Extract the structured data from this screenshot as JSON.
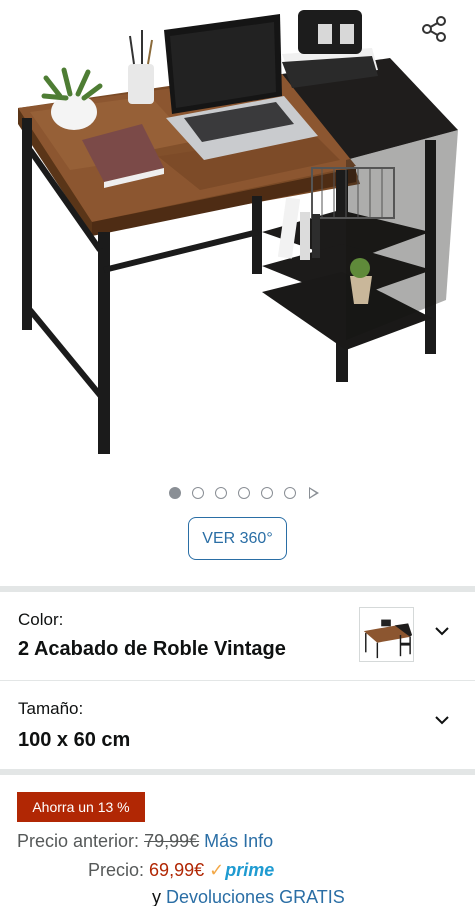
{
  "gallery": {
    "product_image": "desk-with-shelves-photo",
    "share_icon": "share-icon",
    "dot_count": 6,
    "active_dot": 0,
    "has_video_indicator": true,
    "view360_label": "VER 360°"
  },
  "color": {
    "label": "Color:",
    "value": "2 Acabado de Roble Vintage",
    "thumbnail": "desk-thumbnail"
  },
  "size": {
    "label": "Tamaño:",
    "value": "100 x 60 cm"
  },
  "pricing": {
    "savings_badge": "Ahorra un 13 %",
    "previous_label": "Precio anterior:",
    "previous_price": "79,99€",
    "more_info": "Más Info",
    "price_label": "Precio:",
    "price": "69,99€",
    "prime_label": "prime",
    "returns_prefix": "y",
    "returns_link": "Devoluciones GRATIS"
  },
  "colors": {
    "accent_link": "#2a6ea5",
    "deal_red": "#b12704",
    "prime_blue": "#1f9bd1",
    "prime_check": "#f3a847"
  }
}
